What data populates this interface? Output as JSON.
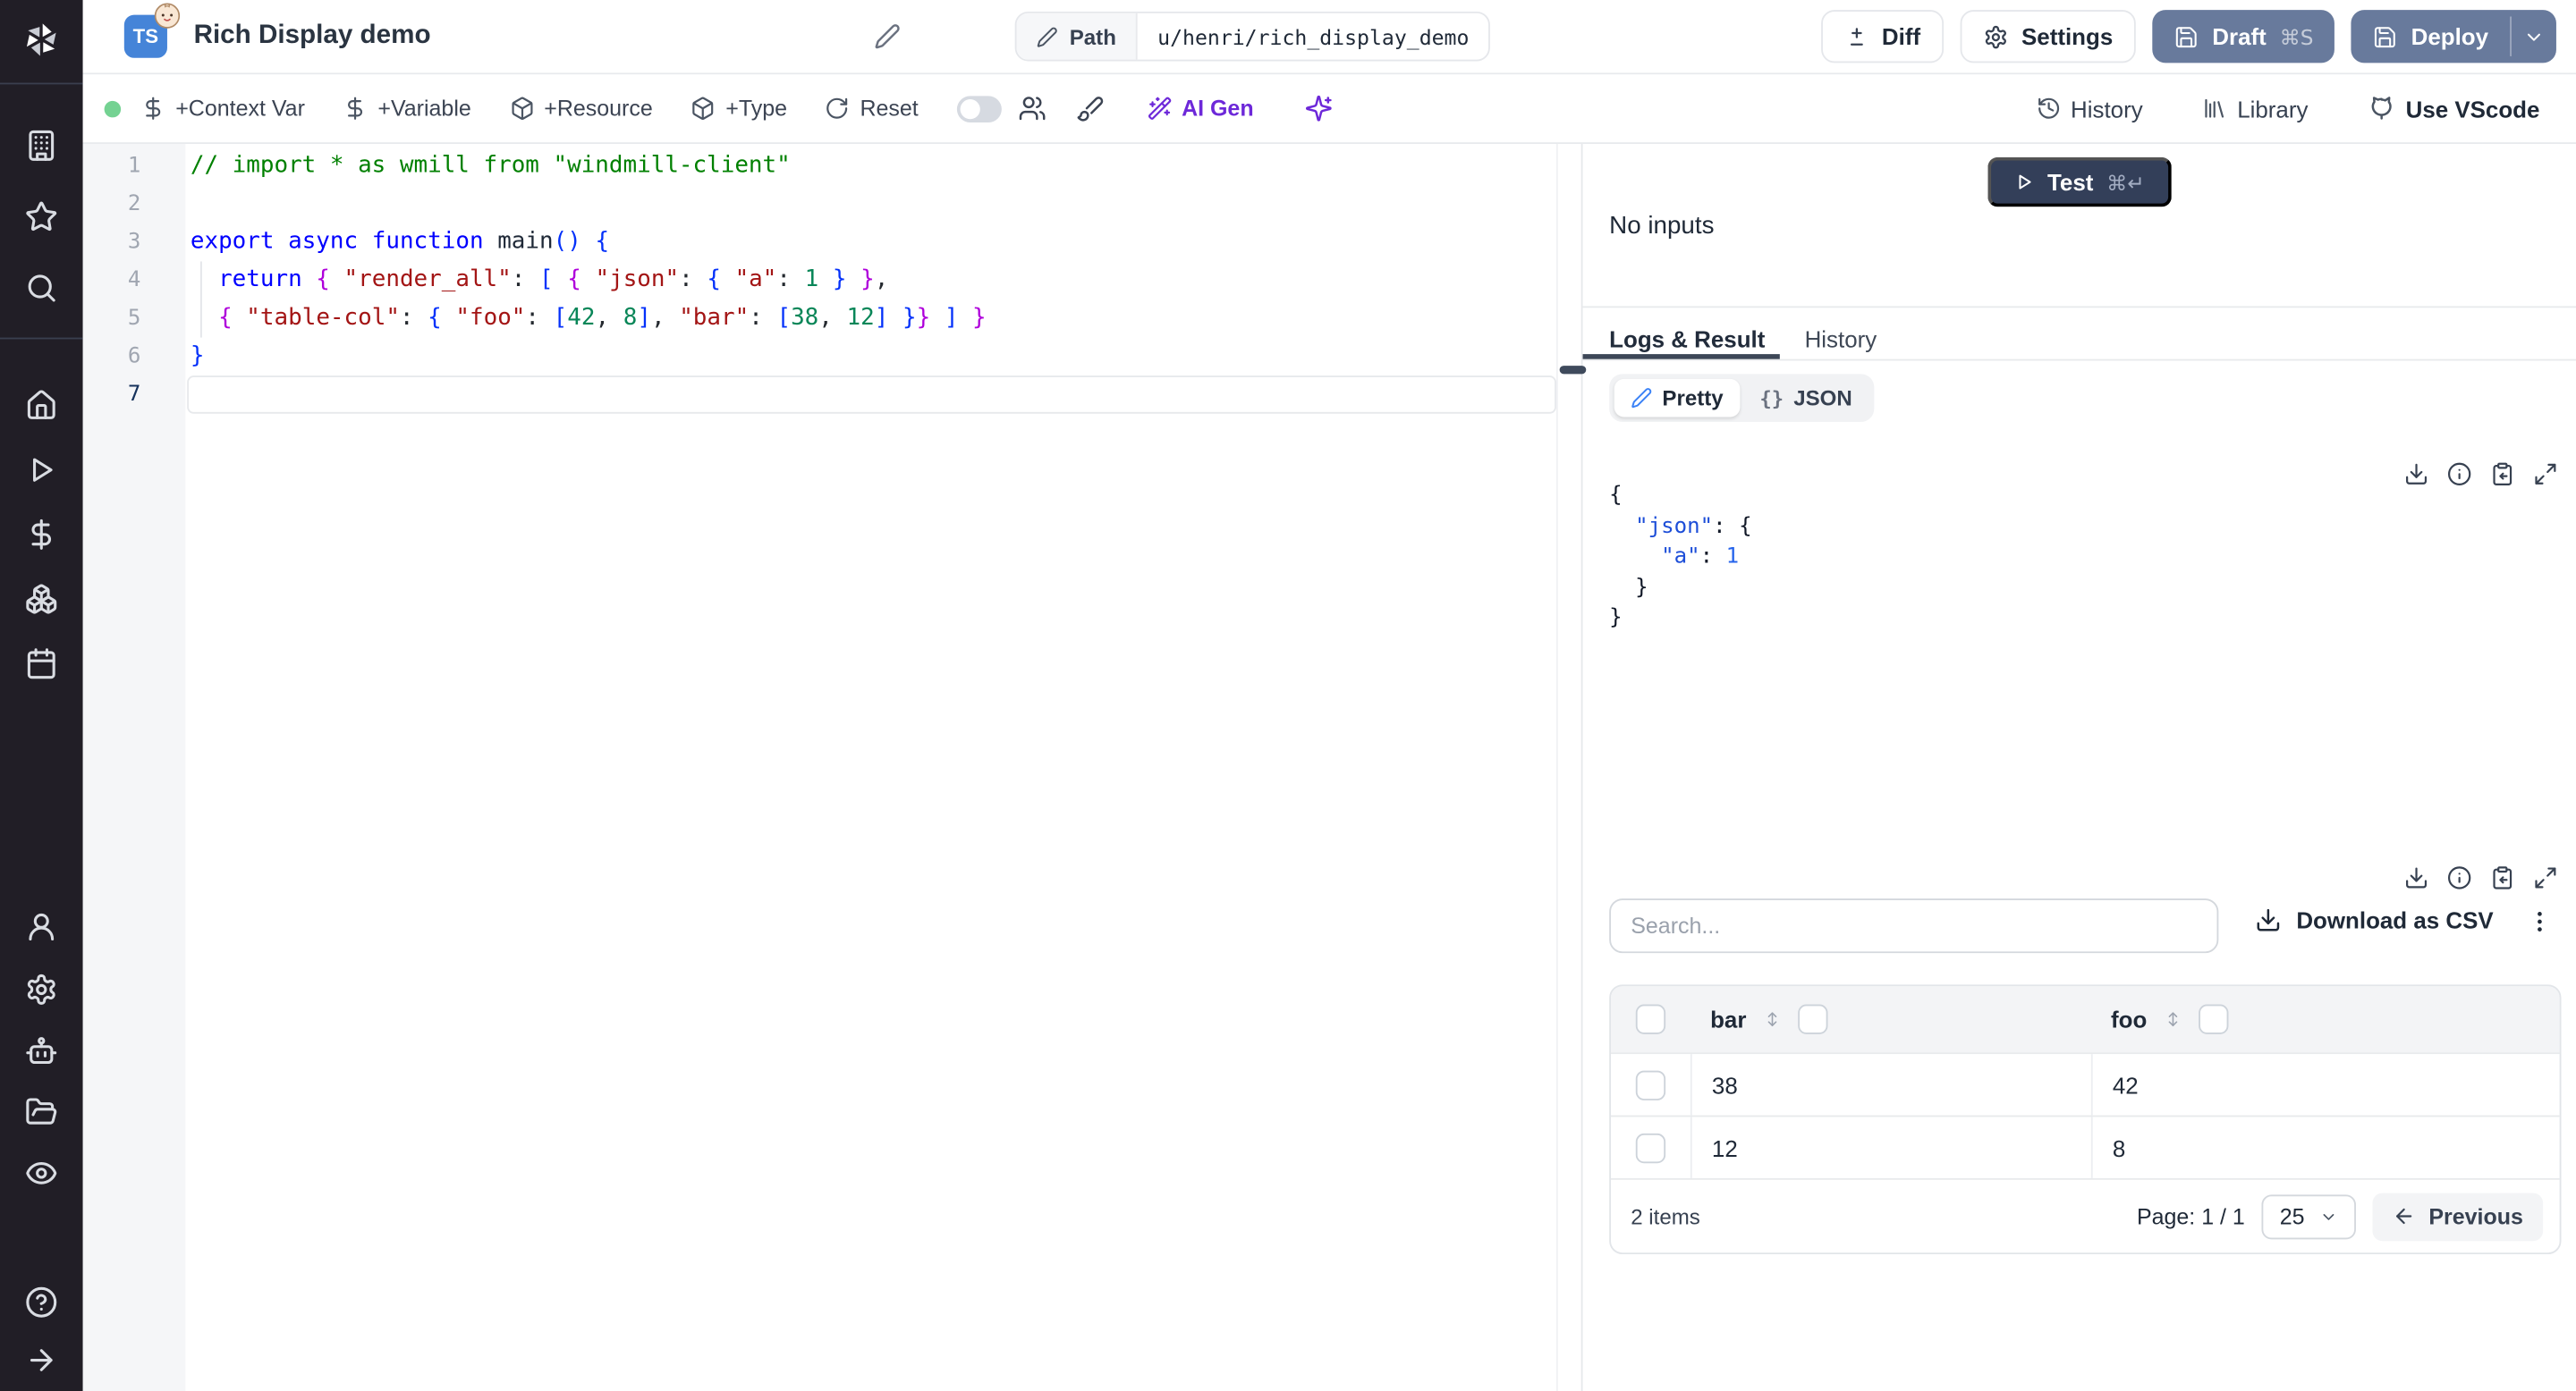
{
  "header": {
    "language_badge": "TS",
    "title": "Rich Display demo",
    "path_label": "Path",
    "path_value": "u/henri/rich_display_demo",
    "diff_label": "Diff",
    "settings_label": "Settings",
    "draft_label": "Draft",
    "draft_shortcut": "⌘S",
    "deploy_label": "Deploy"
  },
  "sidebar": {
    "icons": [
      "windmill-logo",
      "building",
      "star",
      "search",
      "home",
      "play",
      "dollar",
      "boxes",
      "calendar",
      "user",
      "settings-gear",
      "bot",
      "folder-open",
      "eye",
      "help-circle",
      "arrow-right"
    ]
  },
  "toolbar": {
    "context_var": "+Context Var",
    "variable": "+Variable",
    "resource": "+Resource",
    "type": "+Type",
    "reset": "Reset",
    "ai_gen": "AI Gen",
    "history": "History",
    "library": "Library",
    "vscode": "Use VScode"
  },
  "editor": {
    "lines": [
      {
        "num": "1",
        "tokens": [
          [
            "// import * as wmill from \"windmill-client\"",
            "cm"
          ]
        ]
      },
      {
        "num": "2",
        "tokens": []
      },
      {
        "num": "3",
        "tokens": [
          [
            "export",
            "kw"
          ],
          [
            " ",
            "pl"
          ],
          [
            "async",
            "kw"
          ],
          [
            " ",
            "pl"
          ],
          [
            "function",
            "kw"
          ],
          [
            " ",
            "pl"
          ],
          [
            "main",
            "fn"
          ],
          [
            "(",
            "b1"
          ],
          [
            ")",
            "b1"
          ],
          [
            " ",
            "pl"
          ],
          [
            "{",
            "b1"
          ]
        ]
      },
      {
        "num": "4",
        "tokens": [
          [
            "  ",
            "pl"
          ],
          [
            "return",
            "kw"
          ],
          [
            " ",
            "pl"
          ],
          [
            "{",
            "b2"
          ],
          [
            " ",
            "pl"
          ],
          [
            "\"render_all\"",
            "st"
          ],
          [
            ":",
            "pl"
          ],
          [
            " ",
            "pl"
          ],
          [
            "[",
            "b3"
          ],
          [
            " ",
            "pl"
          ],
          [
            "{",
            "b4"
          ],
          [
            " ",
            "pl"
          ],
          [
            "\"json\"",
            "st"
          ],
          [
            ":",
            "pl"
          ],
          [
            " ",
            "pl"
          ],
          [
            "{",
            "b5"
          ],
          [
            " ",
            "pl"
          ],
          [
            "\"a\"",
            "st"
          ],
          [
            ":",
            "pl"
          ],
          [
            " ",
            "pl"
          ],
          [
            "1",
            "nu"
          ],
          [
            " ",
            "pl"
          ],
          [
            "}",
            "b5"
          ],
          [
            " ",
            "pl"
          ],
          [
            "}",
            "b4"
          ],
          [
            ",",
            "pl"
          ]
        ]
      },
      {
        "num": "5",
        "tokens": [
          [
            "  ",
            "pl"
          ],
          [
            "{",
            "b4"
          ],
          [
            " ",
            "pl"
          ],
          [
            "\"table-col\"",
            "st"
          ],
          [
            ":",
            "pl"
          ],
          [
            " ",
            "pl"
          ],
          [
            "{",
            "b5"
          ],
          [
            " ",
            "pl"
          ],
          [
            "\"foo\"",
            "st"
          ],
          [
            ":",
            "pl"
          ],
          [
            " ",
            "pl"
          ],
          [
            "[",
            "b6"
          ],
          [
            "42",
            "nu"
          ],
          [
            ",",
            "pl"
          ],
          [
            " ",
            "pl"
          ],
          [
            "8",
            "nu"
          ],
          [
            "]",
            "b6"
          ],
          [
            ",",
            "pl"
          ],
          [
            " ",
            "pl"
          ],
          [
            "\"bar\"",
            "st"
          ],
          [
            ":",
            "pl"
          ],
          [
            " ",
            "pl"
          ],
          [
            "[",
            "b6"
          ],
          [
            "38",
            "nu"
          ],
          [
            ",",
            "pl"
          ],
          [
            " ",
            "pl"
          ],
          [
            "12",
            "nu"
          ],
          [
            "]",
            "b6"
          ],
          [
            " ",
            "pl"
          ],
          [
            "}",
            "b5"
          ],
          [
            "}",
            "b4"
          ],
          [
            " ",
            "pl"
          ],
          [
            "]",
            "b3"
          ],
          [
            " ",
            "pl"
          ],
          [
            "}",
            "b2"
          ]
        ]
      },
      {
        "num": "6",
        "tokens": [
          [
            "}",
            "b1"
          ]
        ]
      },
      {
        "num": "7",
        "tokens": [],
        "active": true
      }
    ]
  },
  "run_panel": {
    "test_label": "Test",
    "test_shortcut": "⌘↵",
    "no_inputs": "No inputs"
  },
  "tabs": {
    "logs": "Logs & Result",
    "history": "History"
  },
  "result_view": {
    "pretty": "Pretty",
    "json": "JSON",
    "json_icon": "{}",
    "lines": [
      [
        [
          "{",
          "jp"
        ]
      ],
      [
        [
          "  ",
          "jp"
        ],
        [
          "\"json\"",
          "jk"
        ],
        [
          ":",
          "jp"
        ],
        [
          " ",
          "jp"
        ],
        [
          "{",
          "jp"
        ]
      ],
      [
        [
          "    ",
          "jp"
        ],
        [
          "\"a\"",
          "jk"
        ],
        [
          ":",
          "jp"
        ],
        [
          " ",
          "jp"
        ],
        [
          "1",
          "jn"
        ]
      ],
      [
        [
          "  }",
          "jp"
        ]
      ],
      [
        [
          "}",
          "jp"
        ]
      ]
    ]
  },
  "result_table": {
    "search_placeholder": "Search...",
    "download_csv": "Download as CSV",
    "columns": [
      "bar",
      "foo"
    ],
    "rows": [
      [
        "38",
        "42"
      ],
      [
        "12",
        "8"
      ]
    ],
    "items_label": "2 items",
    "page_label": "Page: 1 / 1",
    "page_size": "25",
    "previous_label": "Previous"
  },
  "colors": {
    "accent_button": "#687a9c",
    "test_button": "#333f59",
    "ai_purple": "#6d28d9",
    "status_green": "#74d292",
    "ts_badge_blue": "#4584d8",
    "sidebar_bg": "#211e26"
  }
}
